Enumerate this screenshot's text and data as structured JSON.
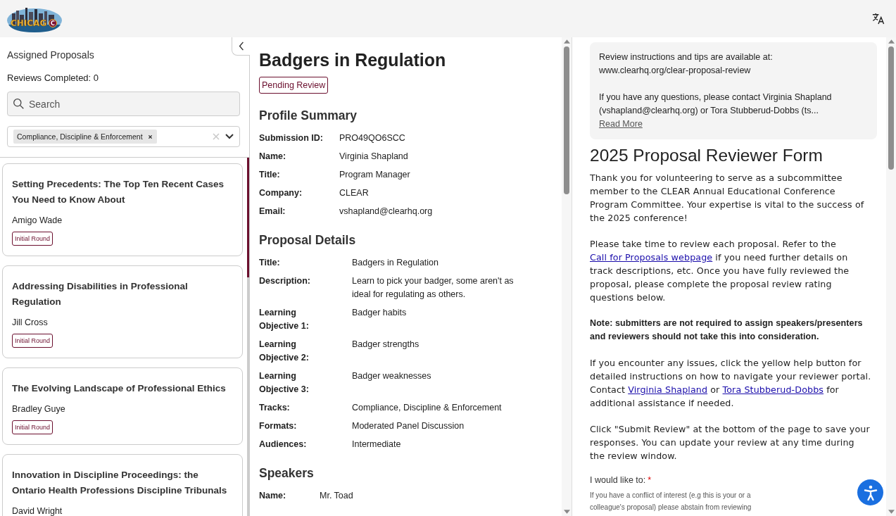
{
  "header": {
    "logo": {
      "text": "CHICAG",
      "mark": "C"
    }
  },
  "sidebar": {
    "title": "Assigned Proposals",
    "reviews_completed": "Reviews Completed: 0",
    "search": {
      "placeholder": "Search"
    },
    "filter": {
      "tags": [
        "Compliance, Discipline & Enforcement"
      ]
    },
    "proposals": [
      {
        "title": "Setting Precedents: The Top Ten Recent Cases You Need to Know About",
        "speaker": "Amigo Wade",
        "badge": "Initial Round",
        "selected": false
      },
      {
        "title": "Addressing Disabilities in Professional Regulation",
        "speaker": "Jill Cross",
        "badge": "Initial Round",
        "selected": false
      },
      {
        "title": "The Evolving Landscape of Professional Ethics",
        "speaker": "Bradley Guye",
        "badge": "Initial Round",
        "selected": false
      },
      {
        "title": "Innovation in Discipline Proceedings: the Ontario Health Professions Discipline Tribunals",
        "speaker": "David Wright",
        "selected": false
      }
    ]
  },
  "proposal": {
    "title": "Badgers in Regulation",
    "status": "Pending Review",
    "sections": [
      {
        "heading": "Profile Summary",
        "kind": "profile",
        "rows": [
          {
            "label": "Submission ID:",
            "value": "PRO49QO6SCC"
          },
          {
            "label": "Name:",
            "value": "Virginia Shapland"
          },
          {
            "label": "Title:",
            "value": "Program Manager"
          },
          {
            "label": "Company:",
            "value": "CLEAR"
          },
          {
            "label": "Email:",
            "value": "vshapland@clearhq.org"
          }
        ]
      },
      {
        "heading": "Proposal Details",
        "kind": "details",
        "rows": [
          {
            "label": "Title:",
            "value": "Badgers in Regulation"
          },
          {
            "label": "Description:",
            "value": "Learn to pick your badger, some aren't as ideal for regulating as others."
          },
          {
            "label": "Learning Objective 1:",
            "value": "Badger habits"
          },
          {
            "label": "Learning Objective 2:",
            "value": "Badger strengths"
          },
          {
            "label": "Learning Objective 3:",
            "value": "Badger weaknesses"
          },
          {
            "label": "Tracks:",
            "value": "Compliance, Discipline & Enforcement"
          },
          {
            "label": "Formats:",
            "value": "Moderated Panel Discussion"
          },
          {
            "label": "Audiences:",
            "value": "Intermediate"
          }
        ]
      },
      {
        "heading": "Speakers",
        "kind": "speakers",
        "rows": [
          {
            "label": "Name:",
            "value": "Mr. Toad"
          }
        ]
      }
    ]
  },
  "review_form": {
    "info": {
      "paragraphs": [
        "Review instructions and tips are available at: www.clearhq.org/clear-proposal-review",
        "If you have any questions, please contact Virginia Shapland (vshapland@clearhq.org) or Tora Stubberud-Dobbs (ts..."
      ],
      "read_more": "Read More"
    },
    "title": "2025 Proposal Reviewer Form",
    "paragraphs": [
      {
        "kind": "plain",
        "parts": [
          {
            "text": "Thank you for volunteering to serve as a subcommittee member to the CLEAR Annual Educational Conference Program Committee. Your expertise is vital to the success of the 2025 conference!"
          }
        ]
      },
      {
        "kind": "plain",
        "parts": [
          {
            "text": "Please take time to review each proposal. Refer to the "
          },
          {
            "text": "Call for Proposals webpage",
            "link": true
          },
          {
            "text": " if you need further details on track descriptions, etc. Once you have fully reviewed the proposal, please complete the proposal review rating questions below."
          }
        ]
      },
      {
        "kind": "note",
        "parts": [
          {
            "text": "Note: submitters are not required to assign speakers/presenters and reviewers should not take this into consideration."
          }
        ]
      },
      {
        "kind": "plain",
        "parts": [
          {
            "text": "If you encounter any issues, click the yellow help button for detailed instructions on how to navigate your reviewer portal. Contact "
          },
          {
            "text": "Virginia Shapland",
            "link": true
          },
          {
            "text": " or "
          },
          {
            "text": "Tora Stubberud-Dobbs",
            "link": true
          },
          {
            "text": " for additional assistance if needed."
          }
        ]
      },
      {
        "kind": "plain",
        "parts": [
          {
            "text": "Click \"Submit Review\" at the bottom of the page to save your responses. You can update your review at any time during the review window."
          }
        ]
      }
    ],
    "question": {
      "label": "I would like to:",
      "required": true,
      "required_mark": "*",
      "hint": "If you have a conflict of interest (e.g this is your or a colleague's proposal) please abstain from reviewing"
    }
  }
}
